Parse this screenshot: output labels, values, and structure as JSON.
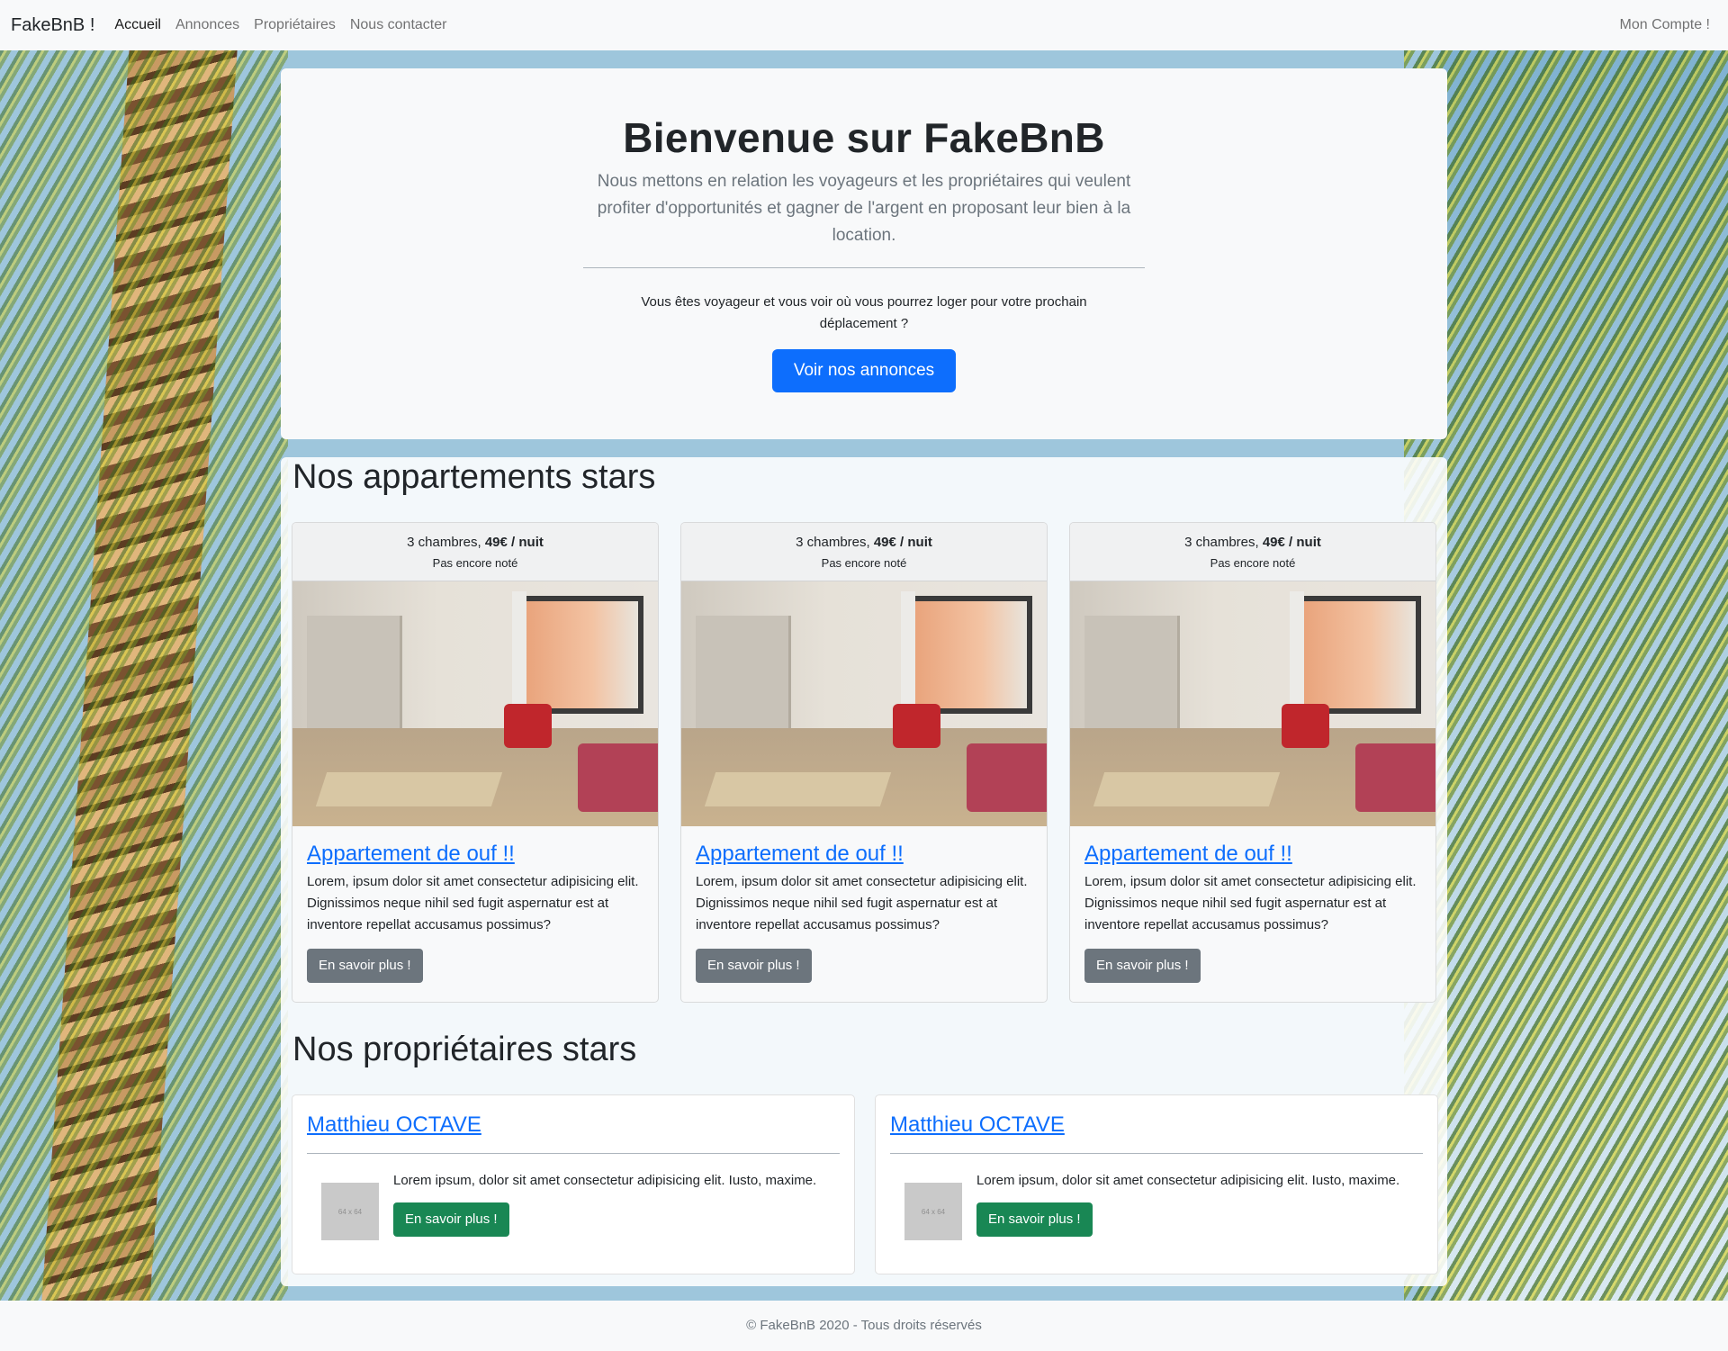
{
  "nav": {
    "brand": "FakeBnB !",
    "links": [
      "Accueil",
      "Annonces",
      "Propriétaires",
      "Nous contacter"
    ],
    "account": "Mon Compte !"
  },
  "hero": {
    "title": "Bienvenue sur FakeBnB",
    "lead": "Nous mettons en relation les voyageurs et les propriétaires qui veulent profiter d'opportunités et gagner de l'argent en proposant leur bien à la location.",
    "sub": "Vous êtes voyageur et vous voir où vous pourrez loger pour votre prochain déplacement ?",
    "button": "Voir nos annonces"
  },
  "apartments": {
    "title": "Nos appartements stars",
    "items": [
      {
        "rooms": "3 chambres,",
        "price": "49€ / nuit",
        "rating": "Pas encore noté",
        "title": "Appartement de ouf !!",
        "text": "Lorem, ipsum dolor sit amet consectetur adipisicing elit. Dignissimos neque nihil sed fugit aspernatur est at inventore repellat accusamus possimus?",
        "button": "En savoir plus !"
      },
      {
        "rooms": "3 chambres,",
        "price": "49€ / nuit",
        "rating": "Pas encore noté",
        "title": "Appartement de ouf !!",
        "text": "Lorem, ipsum dolor sit amet consectetur adipisicing elit. Dignissimos neque nihil sed fugit aspernatur est at inventore repellat accusamus possimus?",
        "button": "En savoir plus !"
      },
      {
        "rooms": "3 chambres,",
        "price": "49€ / nuit",
        "rating": "Pas encore noté",
        "title": "Appartement de ouf !!",
        "text": "Lorem, ipsum dolor sit amet consectetur adipisicing elit. Dignissimos neque nihil sed fugit aspernatur est at inventore repellat accusamus possimus?",
        "button": "En savoir plus !"
      }
    ]
  },
  "owners": {
    "title": "Nos propriétaires stars",
    "items": [
      {
        "name": "Matthieu OCTAVE",
        "thumb": "64 x 64",
        "text": "Lorem ipsum, dolor sit amet consectetur adipisicing elit. Iusto, maxime.",
        "button": "En savoir plus !"
      },
      {
        "name": "Matthieu OCTAVE",
        "thumb": "64 x 64",
        "text": "Lorem ipsum, dolor sit amet consectetur adipisicing elit. Iusto, maxime.",
        "button": "En savoir plus !"
      }
    ]
  },
  "footer": "© FakeBnB 2020 - Tous droits réservés",
  "colors": {
    "primary": "#0d6efd",
    "secondary": "#6c757d",
    "success": "#198754",
    "light": "#f8f9fa"
  }
}
